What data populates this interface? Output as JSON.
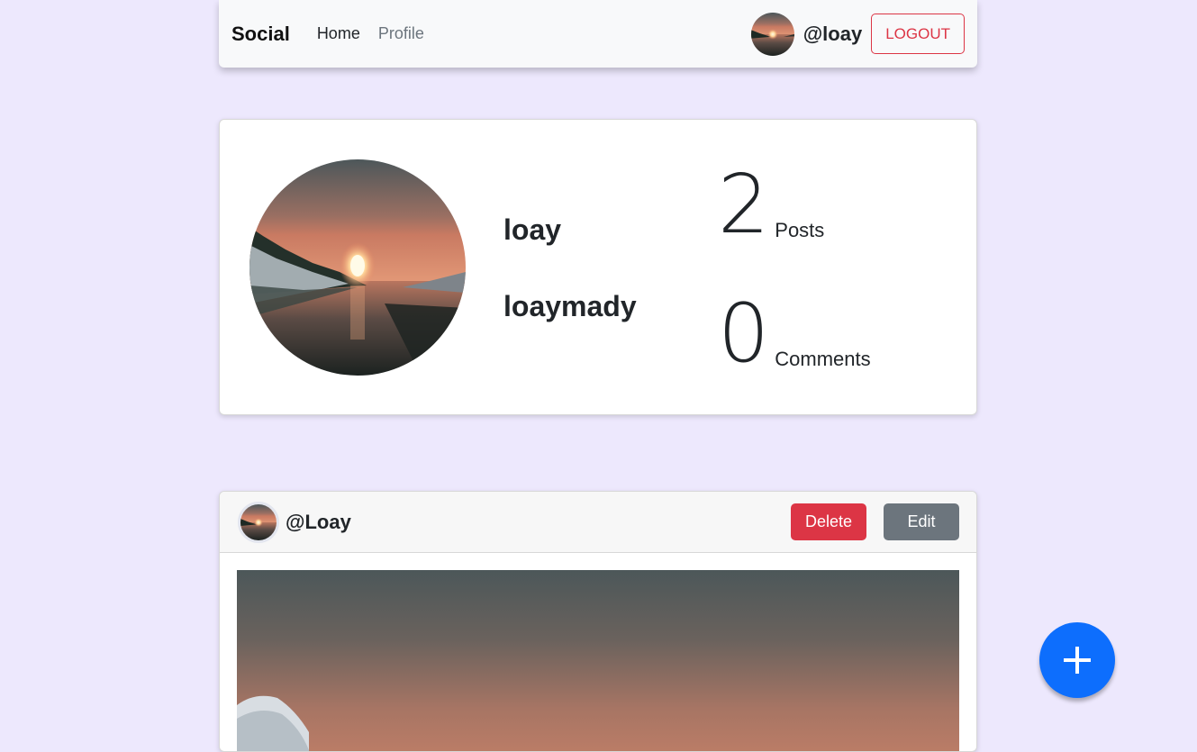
{
  "navbar": {
    "brand": "Social",
    "links": [
      {
        "label": "Home",
        "active": true
      },
      {
        "label": "Profile",
        "active": false
      }
    ],
    "current_user": "@loay",
    "logout_label": "LOGOUT"
  },
  "profile": {
    "name": "loay",
    "username": "loaymady",
    "posts_count": "2",
    "posts_label": "Posts",
    "comments_count": "0",
    "comments_label": "Comments"
  },
  "post": {
    "author": "@Loay",
    "delete_label": "Delete",
    "edit_label": "Edit"
  },
  "fab": {
    "icon": "plus-icon"
  },
  "colors": {
    "page_bg": "#ede8fd",
    "primary": "#0d6efd",
    "danger": "#dc3545",
    "secondary": "#6c757d"
  }
}
